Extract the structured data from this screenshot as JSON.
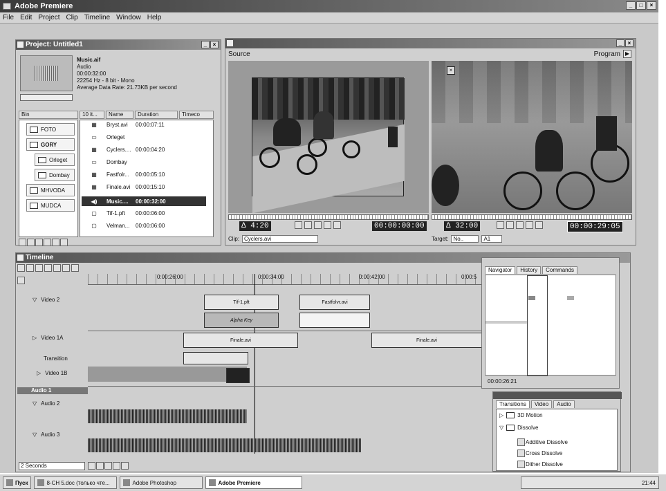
{
  "window": {
    "title": "Adobe Premiere"
  },
  "menu": [
    "File",
    "Edit",
    "Project",
    "Clip",
    "Timeline",
    "Window",
    "Help"
  ],
  "project": {
    "title": "Project: Untitled1",
    "clip_info": {
      "name": "Music.aif",
      "type": "Audio",
      "duration": "00:00:32:00",
      "format": "22254 Hz - 8 bit - Mono",
      "rate": "Average Data Rate: 21.73KB per second"
    },
    "bin_header": "Bin",
    "bins": [
      "FOTO",
      "GORY",
      "Orleget",
      "Dombay",
      "MHVODA",
      "MUDCA"
    ],
    "columns": [
      "10 it...",
      "Name",
      "Duration",
      "Timeco"
    ],
    "items": [
      {
        "name": "Bryst.avi",
        "duration": "00:00:07:11"
      },
      {
        "name": "Orleget",
        "duration": ""
      },
      {
        "name": "Cyclers....",
        "duration": "00:00:04:20"
      },
      {
        "name": "Dombay",
        "duration": ""
      },
      {
        "name": "Fastfolr...",
        "duration": "00:00:05:10"
      },
      {
        "name": "Finale.avi",
        "duration": "00:00:15:10"
      },
      {
        "name": "Music....",
        "duration": "00:00:32:00"
      },
      {
        "name": "Tif-1.pft",
        "duration": "00:00:06:00"
      },
      {
        "name": "Velman...",
        "duration": "00:00:06:00"
      }
    ]
  },
  "monitor": {
    "source_label": "Source",
    "program_label": "Program",
    "source_duration": "Δ 4:20",
    "source_timecode": "00:00:00:00",
    "program_duration": "Δ 32:00",
    "program_timecode": "00:00:29:05",
    "clip_label": "Clip:",
    "clip_value": "Cyclers.avi",
    "target_label": "Target:",
    "target_value": "No..",
    "audio_target": "A1"
  },
  "timeline": {
    "title": "Timeline",
    "ruler": [
      "0:00:26:00",
      "0:00:34:00",
      "0:00:42:00",
      "0:00:5"
    ],
    "tracks": [
      "Video 2",
      "Video 1A",
      "Transition",
      "Video 1B",
      "Audio 1",
      "Audio 2",
      "Audio 3"
    ],
    "clips": {
      "tif": "Tif-1.pft",
      "alpha": "Alpha Key",
      "fastfolr": "Fastfolvr.avi",
      "finale1": "Finale.avi",
      "finale2": "Finale.avi"
    },
    "scale": "2 Seconds"
  },
  "navigator": {
    "tabs": [
      "Navigator",
      "History",
      "Commands"
    ],
    "timecode": "00:00:26:21"
  },
  "transitions": {
    "tabs": [
      "Transitions",
      "Video",
      "Audio"
    ],
    "items": [
      "3D Motion",
      "Dissolve",
      "Additive Dissolve",
      "Cross Dissolve",
      "Dither Dissolve"
    ]
  },
  "taskbar": {
    "start": "Пуск",
    "tasks": [
      "8-CH 5.doc (только чте...",
      "Adobe Photoshop",
      "Adobe Premiere"
    ],
    "clock": "21:44"
  }
}
